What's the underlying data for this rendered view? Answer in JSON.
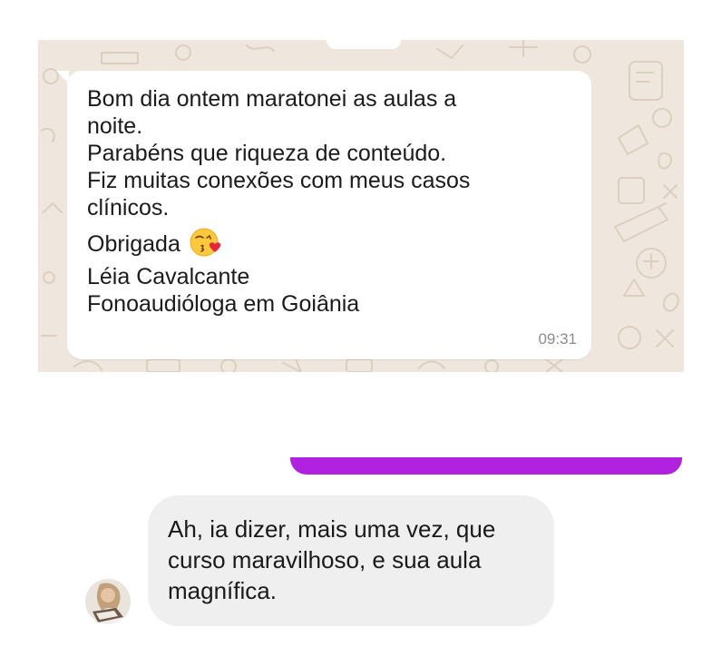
{
  "whatsapp_message": {
    "lines": [
      "Bom dia ontem maratonei as aulas a",
      "noite.",
      "Parabéns que riqueza de conteúdo.",
      "Fiz muitas conexões com meus casos",
      "clínicos.",
      "Obrigada",
      "Léia Cavalcante",
      "Fonoaudióloga em Goiânia"
    ],
    "emoji": "kissing-face-with-heart-icon",
    "time": "09:31"
  },
  "reply_message": {
    "lines": [
      "Ah, ia dizer, mais uma vez, que",
      "curso maravilhoso, e sua aula",
      "magnífica."
    ]
  },
  "colors": {
    "chat_background": "#efe7dd",
    "bubble_incoming": "#ffffff",
    "accent_bar": "#b021e0",
    "reply_bubble": "#efefef"
  }
}
